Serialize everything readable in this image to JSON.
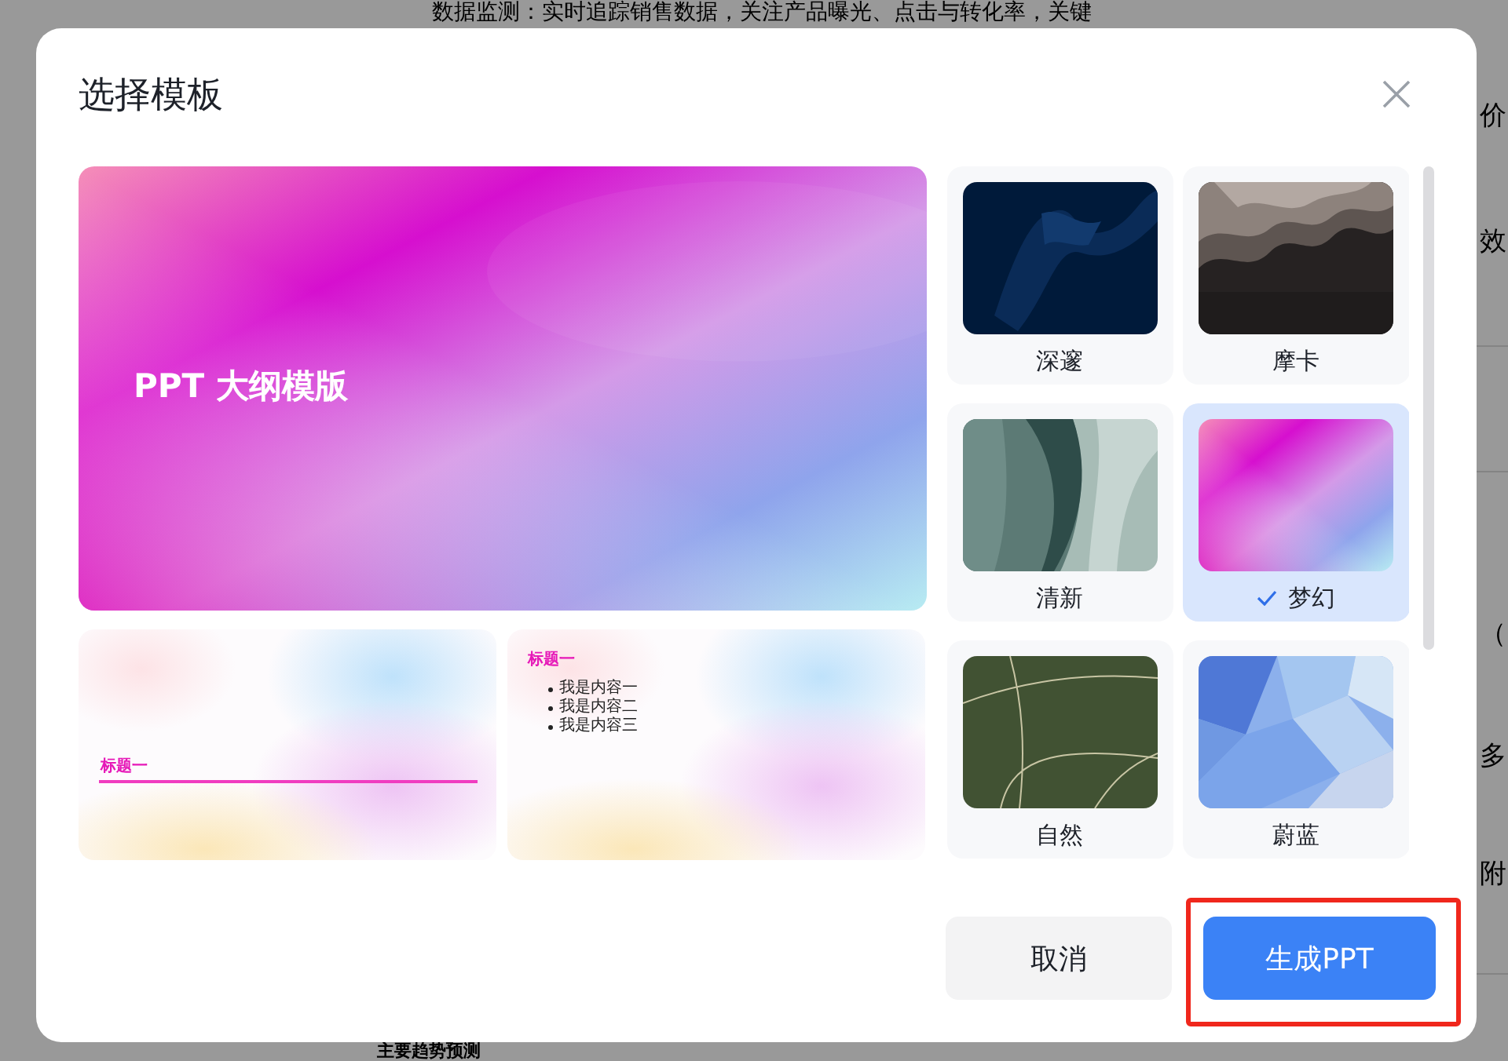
{
  "background_page": {
    "top_text": "数据监测：实时追踪销售数据，关注产品曝光、点击与转化率，关键",
    "side_fragments": [
      "价",
      "效",
      "（",
      "多",
      "附"
    ],
    "bottom_text": "主要趋势预测"
  },
  "dialog": {
    "title": "选择模板",
    "preview": {
      "cover_title": "PPT 大纲模版",
      "slide_2_title": "标题一",
      "slide_3_title": "标题一",
      "slide_3_bullets": [
        "我是内容一",
        "我是内容二",
        "我是内容三"
      ]
    },
    "templates": [
      {
        "name": "深邃",
        "selected": false
      },
      {
        "name": "摩卡",
        "selected": false
      },
      {
        "name": "清新",
        "selected": false
      },
      {
        "name": "梦幻",
        "selected": true
      },
      {
        "name": "自然",
        "selected": false
      },
      {
        "name": "蔚蓝",
        "selected": false
      }
    ],
    "buttons": [
      {
        "label": "取消",
        "kind": "secondary",
        "highlighted": false
      },
      {
        "label": "生成PPT",
        "kind": "primary",
        "highlighted": true
      }
    ]
  }
}
